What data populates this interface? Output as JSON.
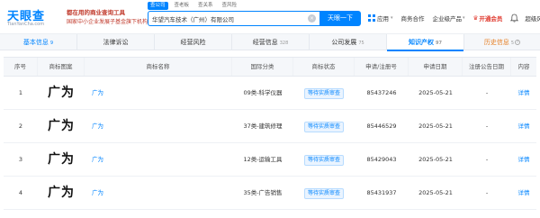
{
  "logo": {
    "title": "天眼查",
    "url": "TianYanCha.com"
  },
  "slogan": {
    "line1": "都在用的商业查询工具",
    "line2": "国家中小企业发展子基金旗下机构"
  },
  "search": {
    "tabs": [
      "查公司",
      "查老板",
      "查关系",
      "查风险"
    ],
    "value": "华望汽车技术（广州）有限公司",
    "button": "天眼一下"
  },
  "nav": {
    "apps": "应用",
    "business": "商务合作",
    "enterprise": "企业级产品",
    "vip": "开通会员",
    "user": "超级风..."
  },
  "tabs": [
    {
      "label": "基本信息",
      "count": "9"
    },
    {
      "label": "法律诉讼",
      "count": ""
    },
    {
      "label": "经营风险",
      "count": ""
    },
    {
      "label": "经营信息",
      "count": "328"
    },
    {
      "label": "公司发展",
      "count": "75"
    },
    {
      "label": "知识产权",
      "count": "97"
    },
    {
      "label": "历史信息",
      "count": "5"
    }
  ],
  "table": {
    "headers": {
      "seq": "序号",
      "image": "商标图案",
      "name": "商标名称",
      "class": "国际分类",
      "status": "商标状态",
      "reg_no": "申请/注册号",
      "date": "申请日期",
      "pub_date": "注册公告日期",
      "content": "内容"
    },
    "rows": [
      {
        "seq": "1",
        "image": "广为",
        "name": "广为",
        "class": "09类-科学仪器",
        "status": "等待实质审查",
        "reg_no": "85437246",
        "date": "2025-05-21",
        "pub_date": "-",
        "content": "详情"
      },
      {
        "seq": "2",
        "image": "广为",
        "name": "广为",
        "class": "37类-建筑修理",
        "status": "等待实质审查",
        "reg_no": "85446529",
        "date": "2025-05-21",
        "pub_date": "-",
        "content": "详情"
      },
      {
        "seq": "3",
        "image": "广为",
        "name": "广为",
        "class": "12类-运输工具",
        "status": "等待实质审查",
        "reg_no": "85429043",
        "date": "2025-05-21",
        "pub_date": "-",
        "content": "详情"
      },
      {
        "seq": "4",
        "image": "广为",
        "name": "广为",
        "class": "35类-广告销售",
        "status": "等待实质审查",
        "reg_no": "85431937",
        "date": "2025-05-21",
        "pub_date": "-",
        "content": "详情"
      }
    ]
  },
  "colors": {
    "brand": "#0084ff",
    "vip": "#e03c31",
    "history": "#e67e22"
  }
}
